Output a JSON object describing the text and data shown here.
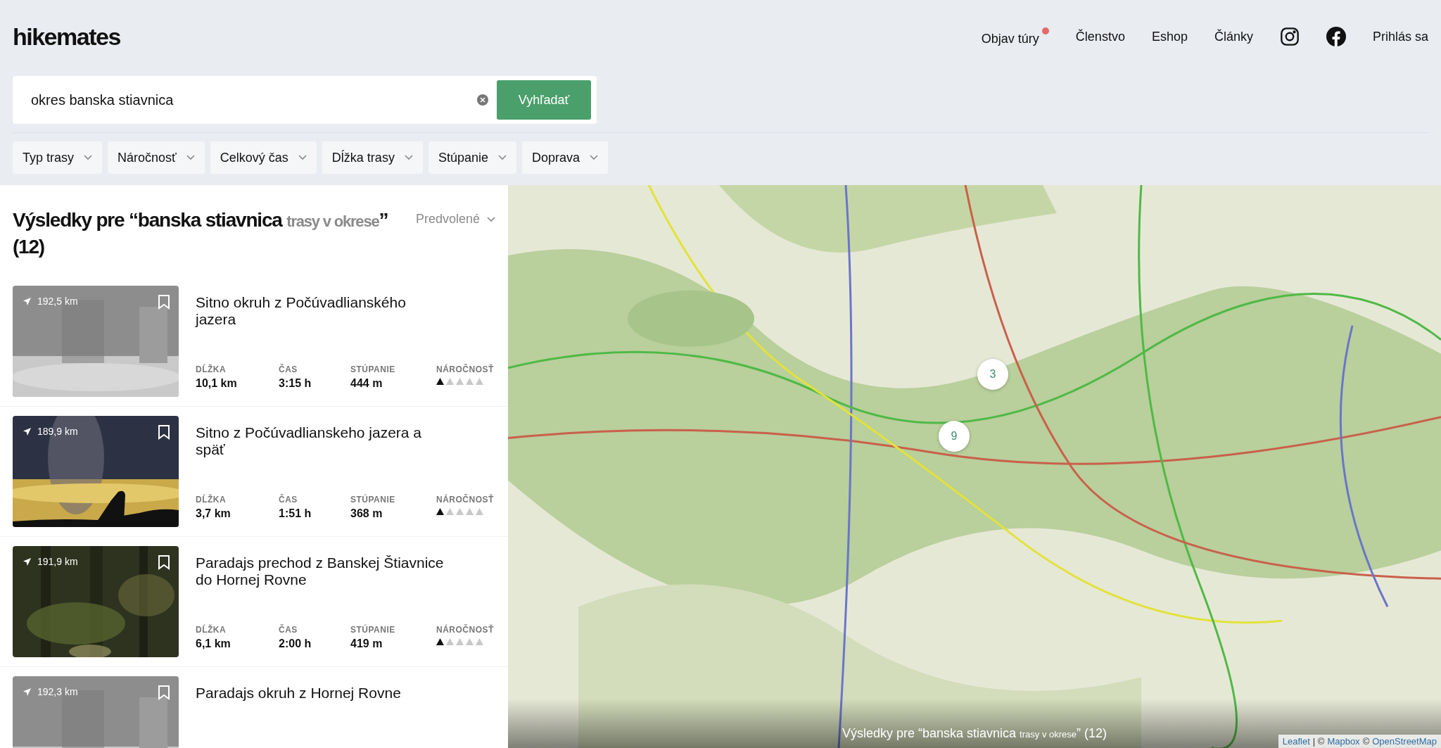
{
  "header": {
    "logo": "hikemates",
    "nav": [
      {
        "label": "Objav túry",
        "dot": true
      },
      {
        "label": "Členstvo",
        "dot": false
      },
      {
        "label": "Eshop",
        "dot": false
      },
      {
        "label": "Články",
        "dot": false
      }
    ],
    "login": "Prihlás sa"
  },
  "search": {
    "value": "okres banska stiavnica",
    "button": "Vyhľadať"
  },
  "filters": [
    "Typ trasy",
    "Náročnosť",
    "Celkový čas",
    "Dĺžka trasy",
    "Stúpanie",
    "Doprava"
  ],
  "results": {
    "title": "Výsledky pre “banska stiavnica",
    "muted": "trasy v okrese",
    "title_end": "”",
    "count": "(12)",
    "sort": "Predvolené"
  },
  "trails": [
    {
      "distance": "192,5 km",
      "title": "Sitno okruh z Počúvadlianského jazera",
      "stats": [
        {
          "label": "DĹŽKA",
          "value": "10,1 km"
        },
        {
          "label": "ČAS",
          "value": "3:15 h"
        },
        {
          "label": "STÚPANIE",
          "value": "444 m"
        }
      ],
      "difficulty_label": "NÁROČNOSŤ",
      "stars": 1
    },
    {
      "distance": "189,9 km",
      "title": "Sitno z Počúvadlianskeho jazera a späť",
      "stats": [
        {
          "label": "DĹŽKA",
          "value": "3,7 km"
        },
        {
          "label": "ČAS",
          "value": "1:51 h"
        },
        {
          "label": "STÚPANIE",
          "value": "368 m"
        }
      ],
      "difficulty_label": "NÁROČNOSŤ",
      "stars": 1
    },
    {
      "distance": "191,9 km",
      "title": "Paradajs prechod z Banskej Štiavnice do Hornej Rovne",
      "stats": [
        {
          "label": "DĹŽKA",
          "value": "6,1 km"
        },
        {
          "label": "ČAS",
          "value": "2:00 h"
        },
        {
          "label": "STÚPANIE",
          "value": "419 m"
        }
      ],
      "difficulty_label": "NÁROČNOSŤ",
      "stars": 1
    },
    {
      "distance": "192,3 km",
      "title": "Paradajs okruh z Hornej Rovne"
    }
  ],
  "map": {
    "kind": "picture",
    "clusters": [
      "3",
      "9"
    ],
    "caption": {
      "title": "Výsledky pre “banska stiavnica",
      "muted": "trasy v okrese",
      "title_end": "” (12)"
    },
    "attribution": [
      {
        "kind": "link",
        "text": "Leaflet"
      },
      {
        "kind": "text",
        "text": "| ©"
      },
      {
        "kind": "link",
        "text": "Mapbox"
      },
      {
        "kind": "text",
        "text": "©"
      },
      {
        "kind": "link",
        "text": "OpenStreetMap"
      }
    ]
  }
}
